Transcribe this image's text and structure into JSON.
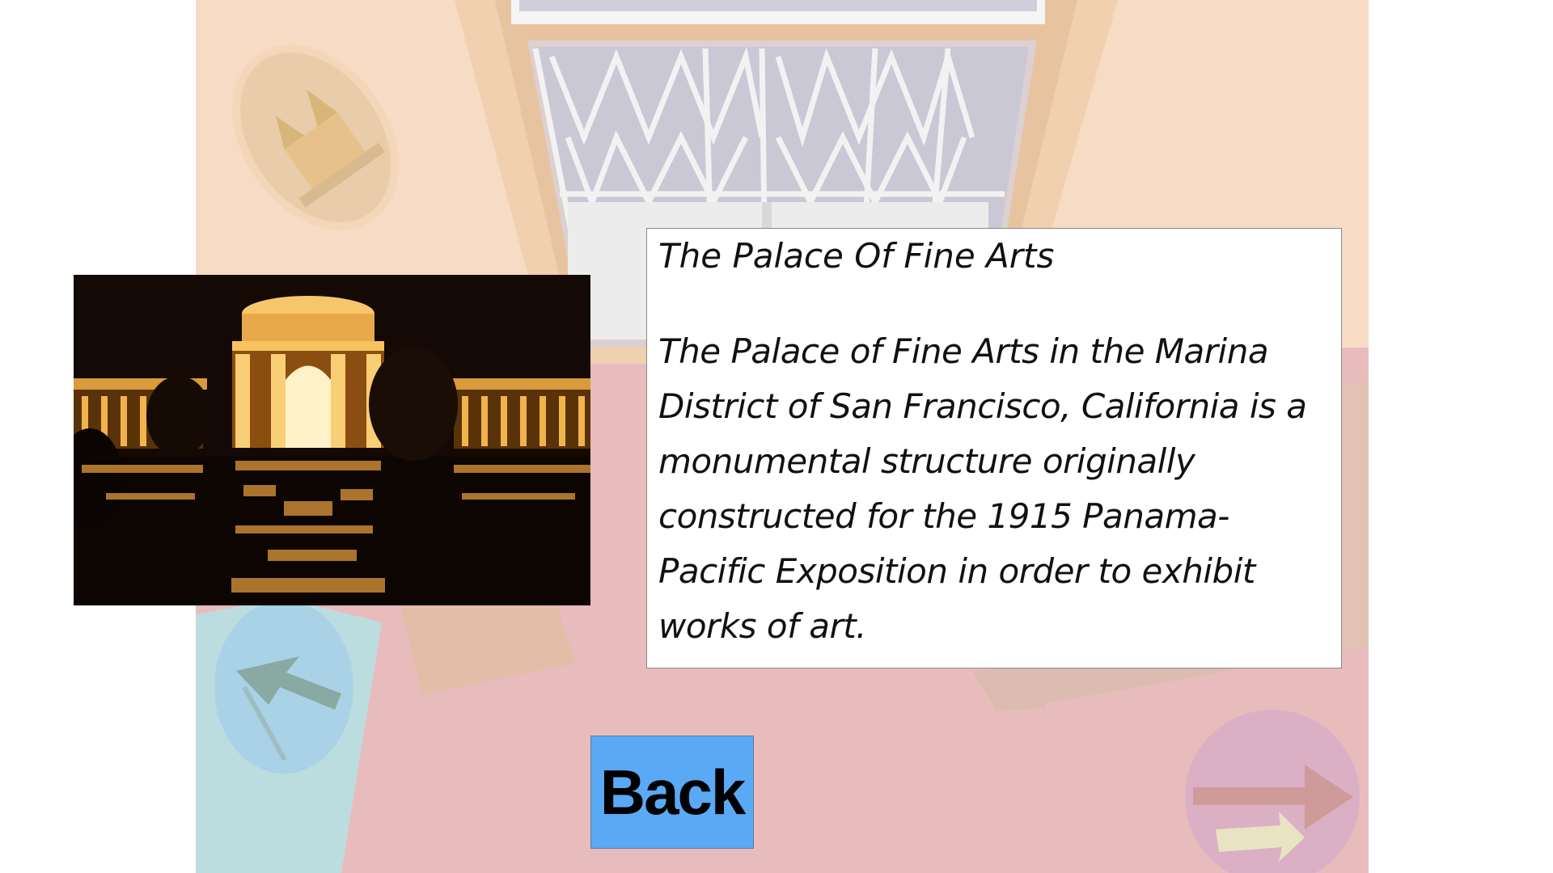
{
  "info": {
    "title": "The Palace Of Fine Arts",
    "body": "The Palace of Fine Arts in the Marina District of San Francisco, California is a monumental structure originally constructed for the 1915 Panama-Pacific Exposition in order to exhibit works of art."
  },
  "buttons": {
    "back_label": "Back"
  },
  "icons": {
    "left_nav": "arrow-up-left-icon",
    "right_nav": "arrow-right-icon",
    "emblem": "castle-emblem-icon"
  },
  "colors": {
    "back_button": "#5aa9f5",
    "scene_peach": "#f6dcc4",
    "scene_pink": "#e8bcbc",
    "scene_blue": "#bcdde0"
  }
}
